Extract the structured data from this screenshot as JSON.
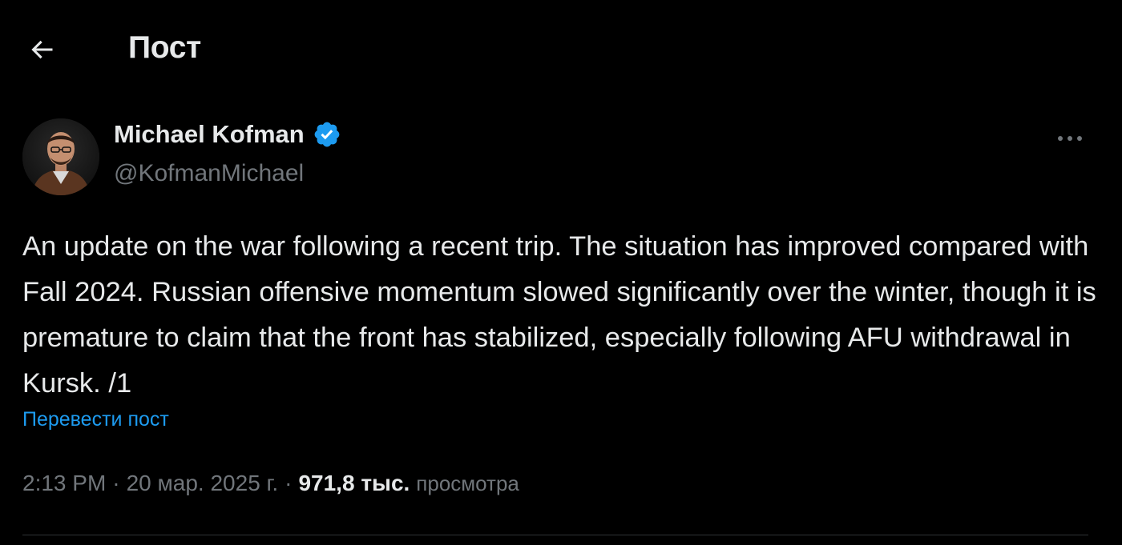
{
  "header": {
    "title": "Пост",
    "back_icon": "arrow-left-icon"
  },
  "author": {
    "display_name": "Michael Kofman",
    "handle": "@KofmanMichael",
    "verified": true,
    "verified_color": "#1d9bf0"
  },
  "post": {
    "text": "An update on the war following a recent trip. The situation has improved compared with Fall 2024. Russian offensive momentum slowed significantly over the winter, though it is premature to claim that the front has stabilized, especially following AFU withdrawal in Kursk. /1",
    "translate_label": "Перевести пост",
    "time": "2:13 PM",
    "date": "20 мар. 2025 г.",
    "separator": "·",
    "views_count": "971,8 тыс.",
    "views_label": "просмотра"
  },
  "colors": {
    "background": "#000000",
    "text_primary": "#e7e9ea",
    "text_secondary": "#71767b",
    "link": "#1d9bf0",
    "divider": "#2f3336"
  }
}
